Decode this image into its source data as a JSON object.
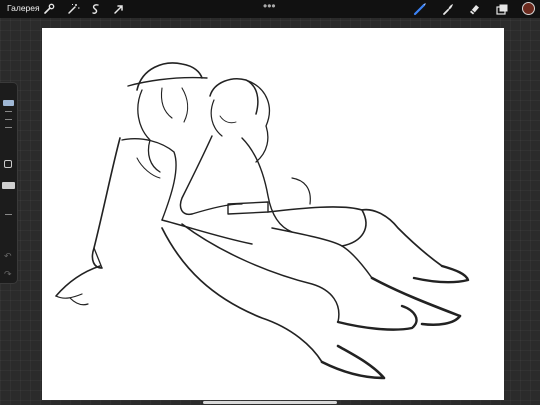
{
  "toolbar": {
    "gallery_label": "Галерея",
    "more_label": "•••",
    "left_tools": [
      "wrench-icon",
      "magic-wand-icon",
      "selection-icon",
      "transform-arrow-icon"
    ],
    "right_tools": [
      "brush-icon",
      "smudge-icon",
      "eraser-icon",
      "layers-icon"
    ],
    "active_color": "#6b2a1e",
    "active_tool_color": "#3b82f6"
  },
  "sidebar": {
    "size_slider": "brush-size-slider",
    "modify_button": "modify-square-icon",
    "opacity_slider": "opacity-slider",
    "undo": "undo-icon",
    "redo": "redo-icon"
  },
  "canvas": {
    "background": "#ffffff",
    "content": "sketch-drawing"
  }
}
